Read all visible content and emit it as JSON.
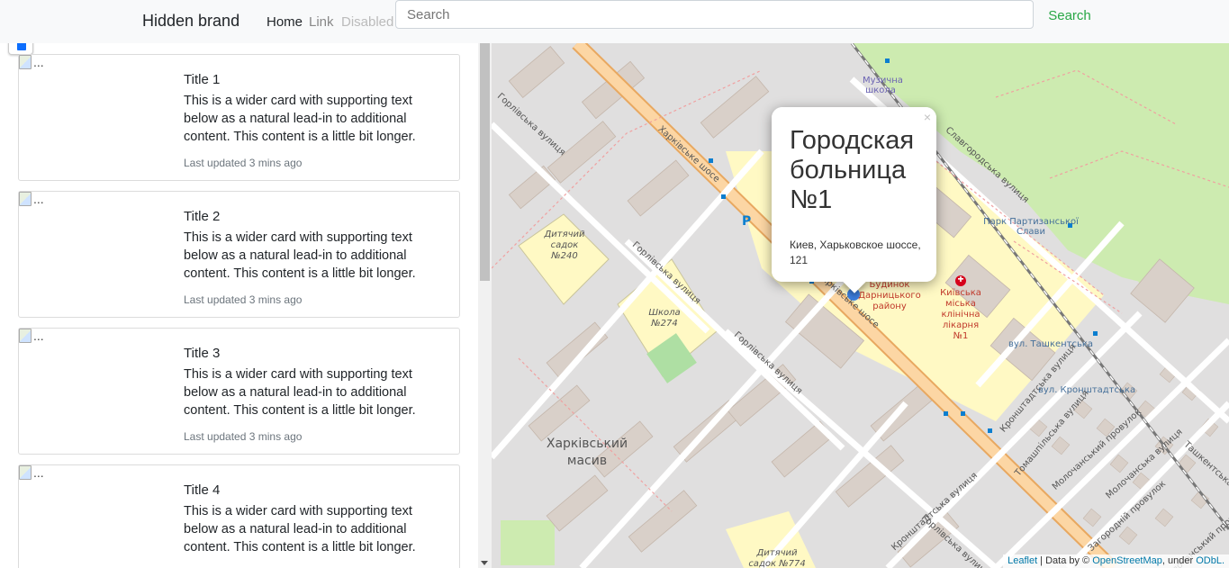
{
  "navbar": {
    "brand": "Hidden brand",
    "links": [
      {
        "label": "Home"
      },
      {
        "label": "Link"
      },
      {
        "label": "Disabled"
      }
    ],
    "search_placeholder": "Search",
    "search_button": "Search"
  },
  "cards": [
    {
      "img_alt": "...",
      "title": "Title 1",
      "text": "This is a wider card with supporting text below as a natural lead-in to additional content. This content is a little bit longer.",
      "meta": "Last updated 3 mins ago"
    },
    {
      "img_alt": "...",
      "title": "Title 2",
      "text": "This is a wider card with supporting text below as a natural lead-in to additional content. This content is a little bit longer.",
      "meta": "Last updated 3 mins ago"
    },
    {
      "img_alt": "...",
      "title": "Title 3",
      "text": "This is a wider card with supporting text below as a natural lead-in to additional content. This content is a little bit longer.",
      "meta": "Last updated 3 mins ago"
    },
    {
      "img_alt": "...",
      "title": "Title 4",
      "text": "This is a wider card with supporting text below as a natural lead-in to additional content. This content is a little bit longer.",
      "meta": ""
    }
  ],
  "map": {
    "popup": {
      "close": "×",
      "title": "Городская больница №1",
      "address": "Киев, Харьковское шоссе, 121"
    },
    "labels": {
      "music_school": "Музична школа",
      "park": "Парк Партизанської Слави",
      "kindergarten_240": "Дитячий садок №240",
      "school_274": "Школа №274",
      "kharkiv_massiv": "Харківський масив",
      "kindergarten_774": "Дитячий садок №774",
      "hospital": "Київська міська клінічна лікарня №1",
      "building": "Будинок Дарницького району",
      "tashkentska": "вул. Ташкентська",
      "kronshtadtska": "вул. Кронштадтська",
      "kharkiv_shose_1": "Харківське шосе",
      "kharkiv_shose_2": "Харківське шосе",
      "horlivska_1": "Горлівська вулиця",
      "horlivska_2": "Горлівська вулиця",
      "horlivska_3": "Горлівська вулиця",
      "horlivska_4": "Горлівська вулиця",
      "slavhorodska": "Славгородська вулиця",
      "kronshtadtska_st": "Кронштадтська вулиця",
      "kronshtadtska_st2": "Кронштадтська вулиця",
      "tomashpilska": "Томашпільська вулиця",
      "molochanskyi": "Молочанський провулок",
      "molochanska": "Молочанська вулиця",
      "tashkentska_st": "Ташкентська вулиця",
      "zahorodnyi": "Загородній провулок",
      "molochanskyi_2": "Молочанський провулок",
      "parking": "P"
    },
    "attribution": {
      "leaflet": "Leaflet",
      "data_by": " | Data by © ",
      "osm": "OpenStreetMap",
      "under": ", under ",
      "odbl": "ODbL."
    },
    "colors": {
      "land": "#f2efe9",
      "buildings": "#d9d0c9",
      "park": "#cdebb0",
      "main_road": "#fcd6a4",
      "residential": "#e0dfdf",
      "hospital_area": "#fff9c4",
      "school_area": "#ffffe5"
    }
  }
}
